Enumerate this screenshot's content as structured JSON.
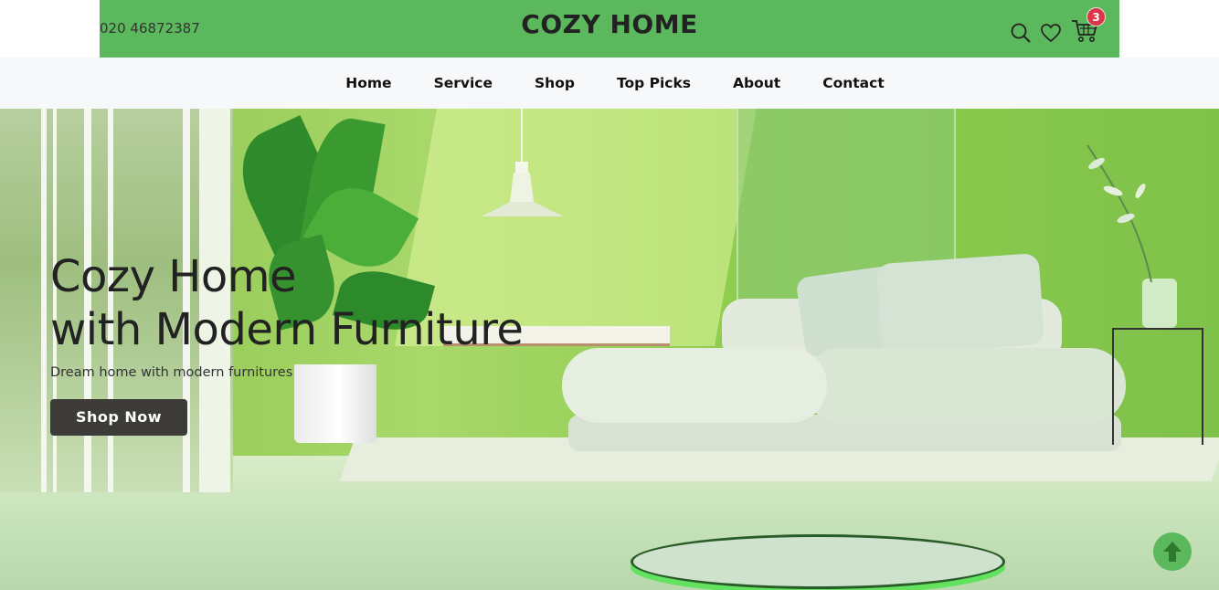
{
  "topbar": {
    "phone": "020 46872387",
    "brand": "COZY HOME",
    "cart_count": "3",
    "icons": [
      "search-icon",
      "heart-icon",
      "cart-icon"
    ],
    "color": "#5cb85c"
  },
  "nav": {
    "items": [
      {
        "label": "Home"
      },
      {
        "label": "Service"
      },
      {
        "label": "Shop"
      },
      {
        "label": "Top Picks"
      },
      {
        "label": "About"
      },
      {
        "label": "Contact"
      }
    ]
  },
  "hero": {
    "title_line1": "Cozy Home",
    "title_line2": "with Modern Furniture",
    "subtitle": "Dream home with modern furnitures",
    "cta_label": "Shop Now"
  },
  "colors": {
    "accent": "#5cb85c",
    "badge": "#dc3545",
    "button": "#3d3b38"
  },
  "scroll_top_icon": "arrow-up-icon"
}
